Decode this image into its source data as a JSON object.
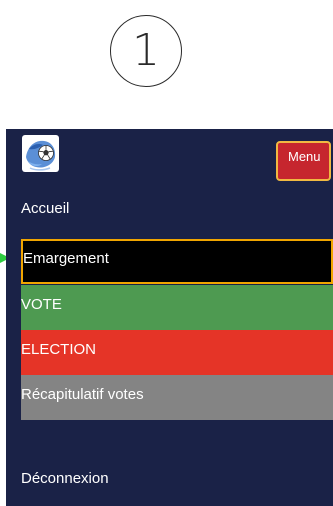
{
  "step": {
    "number": "1"
  },
  "header": {
    "menu_label": "Menu"
  },
  "nav": {
    "accueil": "Accueil",
    "emargement": "Emargement",
    "vote": "VOTE",
    "election": "ELECTION",
    "recap": "Récapitulatif votes",
    "deconnexion": "Déconnexion"
  },
  "colors": {
    "panel_bg": "#1a2247",
    "selected_bg": "#000000",
    "selected_border": "#f0a500",
    "vote_bg": "#4e9a51",
    "election_bg": "#e53427",
    "recap_bg": "#848484",
    "menu_button_bg": "#c6262e",
    "pointer": "#2ecc40"
  },
  "icons": {
    "logo": "soccer-ball-logo-icon",
    "pointer": "arrow-right-icon"
  }
}
